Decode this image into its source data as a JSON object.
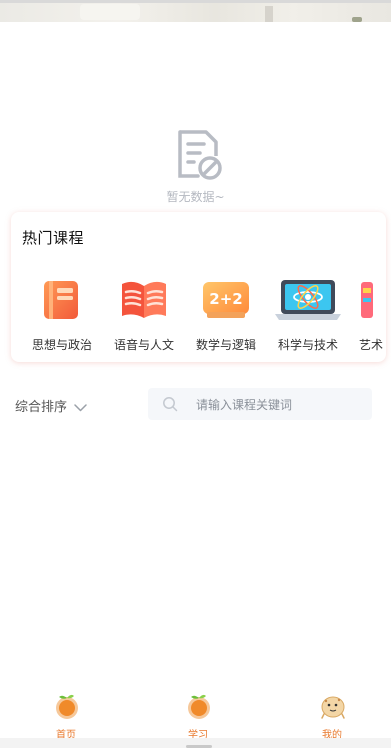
{
  "empty_state": {
    "text": "暂无数据~",
    "icon": "no-data-icon"
  },
  "hot_courses": {
    "title": "热门课程",
    "categories": [
      {
        "label": "思想与政治",
        "icon": "book-icon"
      },
      {
        "label": "语音与人文",
        "icon": "open-book-icon"
      },
      {
        "label": "数学与逻辑",
        "icon": "math-board-icon"
      },
      {
        "label": "科学与技术",
        "icon": "laptop-atom-icon"
      },
      {
        "label": "艺术",
        "icon": "art-icon"
      }
    ]
  },
  "filter": {
    "sort_label": "综合排序",
    "search_placeholder": "请输入课程关键词"
  },
  "tabbar": {
    "tabs": [
      {
        "label": "首页",
        "icon": "orange-fruit-icon"
      },
      {
        "label": "学习",
        "icon": "orange-fruit-icon"
      },
      {
        "label": "我的",
        "icon": "cookie-mascot-icon"
      }
    ]
  },
  "colors": {
    "accent": "#e8792d",
    "muted_text": "#b4b8c0",
    "search_bg": "#f5f7fa"
  }
}
